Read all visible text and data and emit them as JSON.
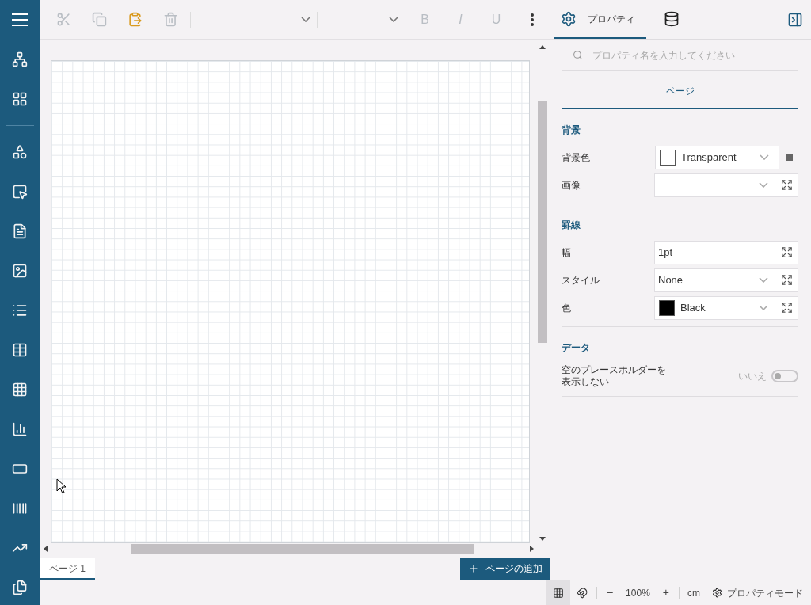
{
  "sidebar": {
    "items": [
      {
        "kind": "hierarchy"
      },
      {
        "kind": "components"
      },
      {
        "kind": "divider"
      },
      {
        "kind": "shapes"
      },
      {
        "kind": "pointer"
      },
      {
        "kind": "document"
      },
      {
        "kind": "image"
      },
      {
        "kind": "list"
      },
      {
        "kind": "table"
      },
      {
        "kind": "grid"
      },
      {
        "kind": "chart"
      },
      {
        "kind": "bar"
      },
      {
        "kind": "barcode"
      },
      {
        "kind": "sparkline"
      },
      {
        "kind": "files"
      }
    ]
  },
  "toolbar": [
    {
      "kind": "cut",
      "disabled": true
    },
    {
      "kind": "copy",
      "disabled": true
    },
    {
      "kind": "paste",
      "disabled": false
    },
    {
      "kind": "delete",
      "disabled": true
    },
    {
      "kind": "separator"
    },
    {
      "kind": "font-dropdown"
    },
    {
      "kind": "separator"
    },
    {
      "kind": "size-dropdown"
    },
    {
      "kind": "separator"
    },
    {
      "kind": "bold",
      "label": "B",
      "disabled": true
    },
    {
      "kind": "italic",
      "label": "I",
      "disabled": true
    },
    {
      "kind": "underline",
      "label": "U",
      "disabled": true
    },
    {
      "kind": "more",
      "disabled": false
    }
  ],
  "panel_tabs": [
    {
      "kind": "properties",
      "label": "プロパティ",
      "selected": true
    },
    {
      "kind": "data",
      "selected": false
    }
  ],
  "search": {
    "placeholder": "プロパティ名を入力してください"
  },
  "object_tabs": [
    {
      "label": "ページ",
      "selected": true
    }
  ],
  "sections": [
    {
      "title": "背景",
      "rows": [
        {
          "label": "背景色",
          "kind": "color",
          "value": "Transparent",
          "color": "#ffffff",
          "expand_button": false,
          "marker": true
        },
        {
          "label": "画像",
          "kind": "select",
          "expand_button": true,
          "marker": false
        }
      ]
    },
    {
      "title": "罫線",
      "rows": [
        {
          "label": "幅",
          "kind": "text",
          "value": "1pt",
          "expand_button": true,
          "marker": false
        },
        {
          "label": "スタイル",
          "kind": "select",
          "value": "None",
          "expand_button": true,
          "marker": false
        },
        {
          "label": "色",
          "kind": "color",
          "value": "Black",
          "color": "#000000",
          "expand_button": true,
          "marker": false
        }
      ]
    },
    {
      "title": "データ",
      "rows": [
        {
          "label": "空のプレースホルダーを表示しない",
          "kind": "toggle",
          "value": "いいえ",
          "on": false
        }
      ]
    }
  ],
  "page_tabs": [
    {
      "label": "ページ 1",
      "selected": true
    }
  ],
  "add_page_button": {
    "label": "ページの追加"
  },
  "status_bar": [
    {
      "kind": "grid",
      "on": true
    },
    {
      "kind": "magnet",
      "on": false
    },
    {
      "kind": "separator"
    },
    {
      "kind": "button",
      "label": "−"
    },
    {
      "kind": "text",
      "label": "100%"
    },
    {
      "kind": "button",
      "label": "+"
    },
    {
      "kind": "separator"
    },
    {
      "kind": "text",
      "label": "cm"
    },
    {
      "kind": "mode",
      "label": "プロパティモード"
    }
  ]
}
